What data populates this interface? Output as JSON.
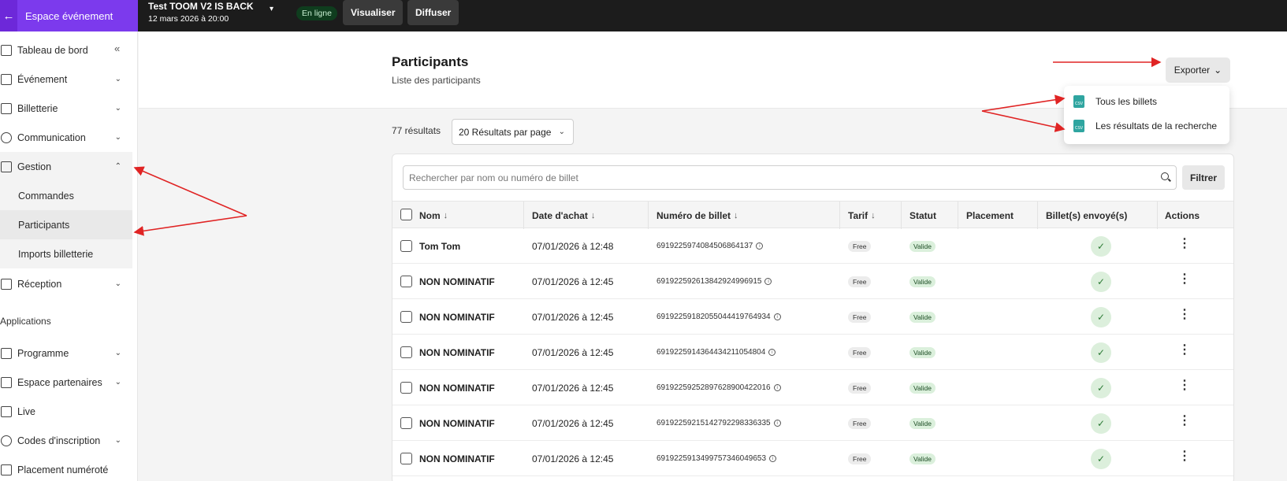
{
  "app": {
    "brand_label": "Espace événement",
    "event_title": "Test TOOM V2 IS BACK",
    "event_date": "12 mars 2026 à 20:00",
    "status": "En ligne",
    "visualize_label": "Visualiser",
    "broadcast_label": "Diffuser"
  },
  "sidebar": {
    "items": [
      {
        "label": "Tableau de bord"
      },
      {
        "label": "Événement"
      },
      {
        "label": "Billetterie"
      },
      {
        "label": "Communication"
      },
      {
        "label": "Gestion"
      },
      {
        "label": "Réception"
      }
    ],
    "sub_items": [
      {
        "label": "Commandes"
      },
      {
        "label": "Participants"
      },
      {
        "label": "Imports billetterie"
      }
    ],
    "section_label": "Applications",
    "app_items": [
      {
        "label": "Programme"
      },
      {
        "label": "Espace partenaires"
      },
      {
        "label": "Live"
      },
      {
        "label": "Codes d'inscription"
      },
      {
        "label": "Placement numéroté"
      }
    ]
  },
  "page": {
    "title": "Participants",
    "subtitle": "Liste des participants",
    "export_label": "Exporter",
    "export_menu": [
      "Tous les billets",
      "Les résultats de la recherche"
    ],
    "results_count": "77 résultats",
    "per_page": "20 Résultats par page",
    "search_placeholder": "Rechercher par nom ou numéro de billet",
    "filter_label": "Filtrer"
  },
  "table": {
    "columns": [
      "Nom",
      "Date d'achat",
      "Numéro de billet",
      "Tarif",
      "Statut",
      "Placement",
      "Billet(s) envoyé(s)",
      "Actions"
    ],
    "rows": [
      {
        "name": "Tom Tom",
        "date": "07/01/2026 à 12:48",
        "ticket": "6919225974084506864137",
        "tarif": "Free",
        "status": "Valide"
      },
      {
        "name": "NON NOMINATIF",
        "date": "07/01/2026 à 12:45",
        "ticket": "6919225926138429249969​15",
        "tarif": "Free",
        "status": "Valide"
      },
      {
        "name": "NON NOMINATIF",
        "date": "07/01/2026 à 12:45",
        "ticket": "691922591820550444197649​34",
        "tarif": "Free",
        "status": "Valide"
      },
      {
        "name": "NON NOMINATIF",
        "date": "07/01/2026 à 12:45",
        "ticket": "69192259143644342110548​04",
        "tarif": "Free",
        "status": "Valide"
      },
      {
        "name": "NON NOMINATIF",
        "date": "07/01/2026 à 12:45",
        "ticket": "69192259252897628900422​016",
        "tarif": "Free",
        "status": "Valide"
      },
      {
        "name": "NON NOMINATIF",
        "date": "07/01/2026 à 12:45",
        "ticket": "69192259215142792298336​335",
        "tarif": "Free",
        "status": "Valide"
      },
      {
        "name": "NON NOMINATIF",
        "date": "07/01/2026 à 12:45",
        "ticket": "69192259134997573460496​53",
        "tarif": "Free",
        "status": "Valide"
      }
    ]
  },
  "colors": {
    "brand": "#7c3aed",
    "annotation": "#e02424"
  }
}
